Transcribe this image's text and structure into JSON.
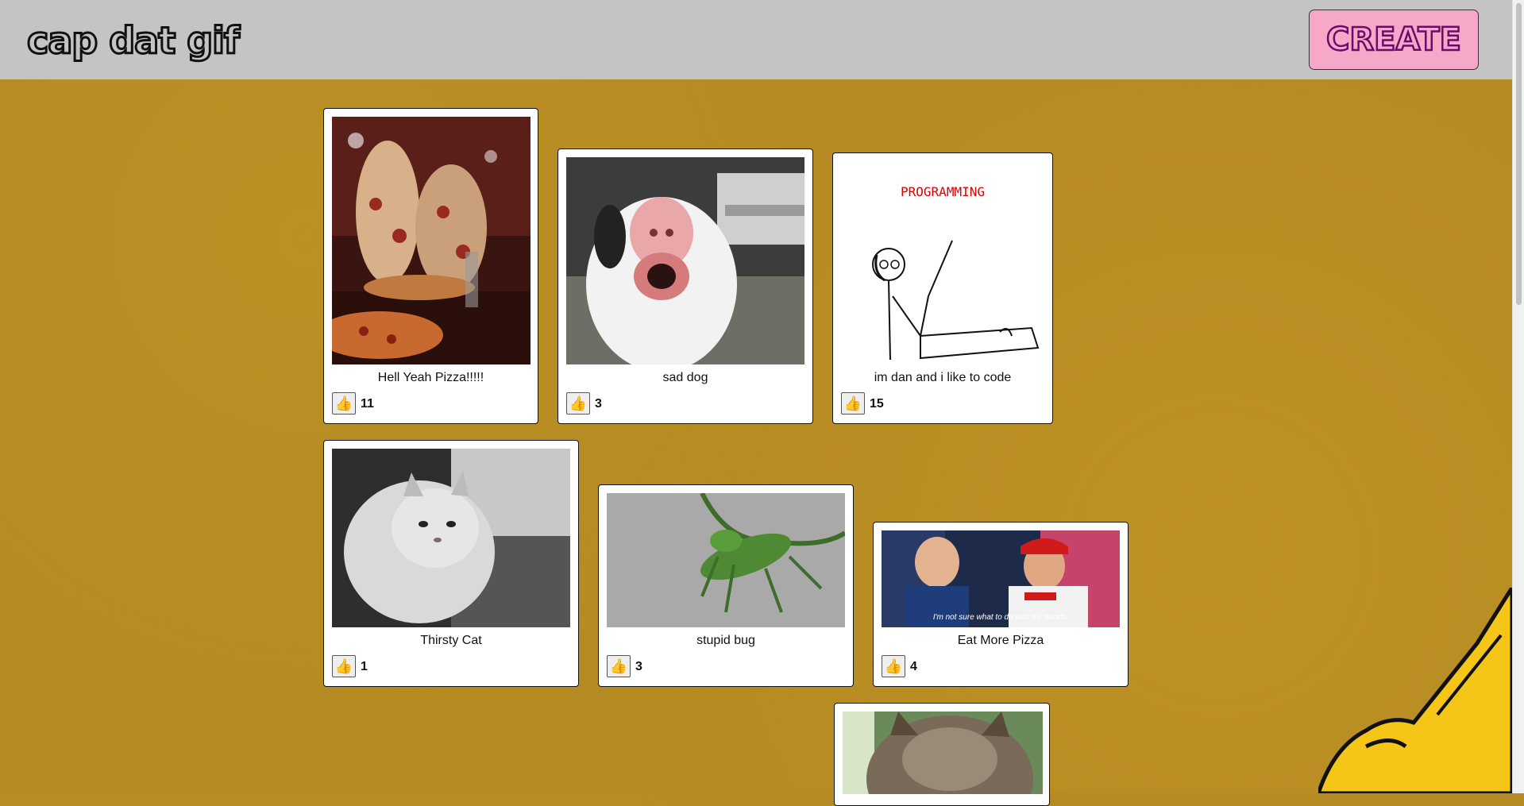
{
  "header": {
    "logo": "cap dat gif",
    "create_label": "CREATE"
  },
  "cards": [
    {
      "caption": "Hell Yeah Pizza!!!!!",
      "likes": "11"
    },
    {
      "caption": "sad dog",
      "likes": "3"
    },
    {
      "caption": "im dan and i like to code",
      "likes": "15",
      "image_text": "PROGRAMMING"
    },
    {
      "caption": "Thirsty Cat",
      "likes": "1"
    },
    {
      "caption": "stupid bug",
      "likes": "3"
    },
    {
      "caption": "Eat More Pizza",
      "likes": "4",
      "image_text": "I'm not sure what to do with my hands."
    },
    {
      "caption": "",
      "likes": ""
    }
  ],
  "icons": {
    "like": "thumbs-up-icon"
  },
  "colors": {
    "header_bg": "#c4c4c4",
    "create_bg": "#f7a8c8",
    "page_bg": "#b58a22"
  }
}
